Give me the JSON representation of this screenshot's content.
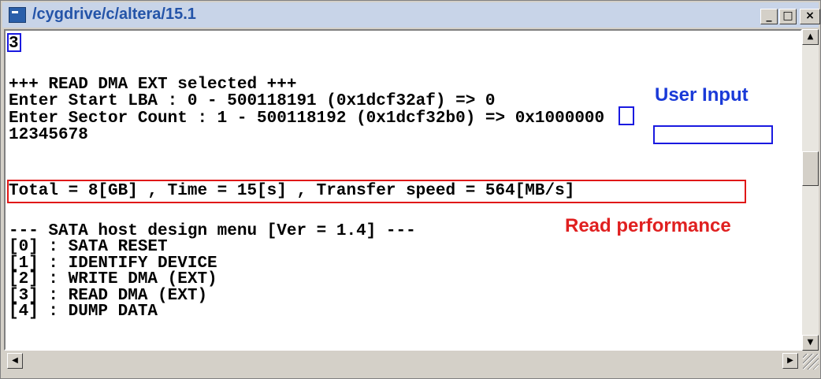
{
  "window": {
    "title": "/cygdrive/c/altera/15.1",
    "minimize_glyph": "_",
    "maximize_glyph": "□",
    "close_glyph": "×"
  },
  "console": {
    "lines": [
      "3",
      "",
      "+++ READ DMA EXT selected +++",
      "Enter Start LBA : 0 - 500118191 (0x1dcf32af) => 0",
      "Enter Sector Count : 1 - 500118192 (0x1dcf32b0) => 0x1000000",
      "12345678",
      "",
      "Total = 8[GB] , Time = 15[s] , Transfer speed = 564[MB/s]",
      "",
      "--- SATA host design menu [Ver = 1.4] ---",
      "[0] : SATA RESET",
      "[1] : IDENTIFY DEVICE",
      "[2] : WRITE DMA (EXT)",
      "[3] : READ DMA (EXT)",
      "[4] : DUMP DATA"
    ]
  },
  "annotations": {
    "user_input": "User Input",
    "read_performance": "Read performance"
  },
  "colors": {
    "annotation_blue": "#1a3ad8",
    "annotation_red": "#e02020",
    "title_text": "#2454a8"
  },
  "scrollbars": {
    "up_arrow": "▲",
    "down_arrow": "▼",
    "left_arrow": "◀",
    "right_arrow": "▶"
  }
}
